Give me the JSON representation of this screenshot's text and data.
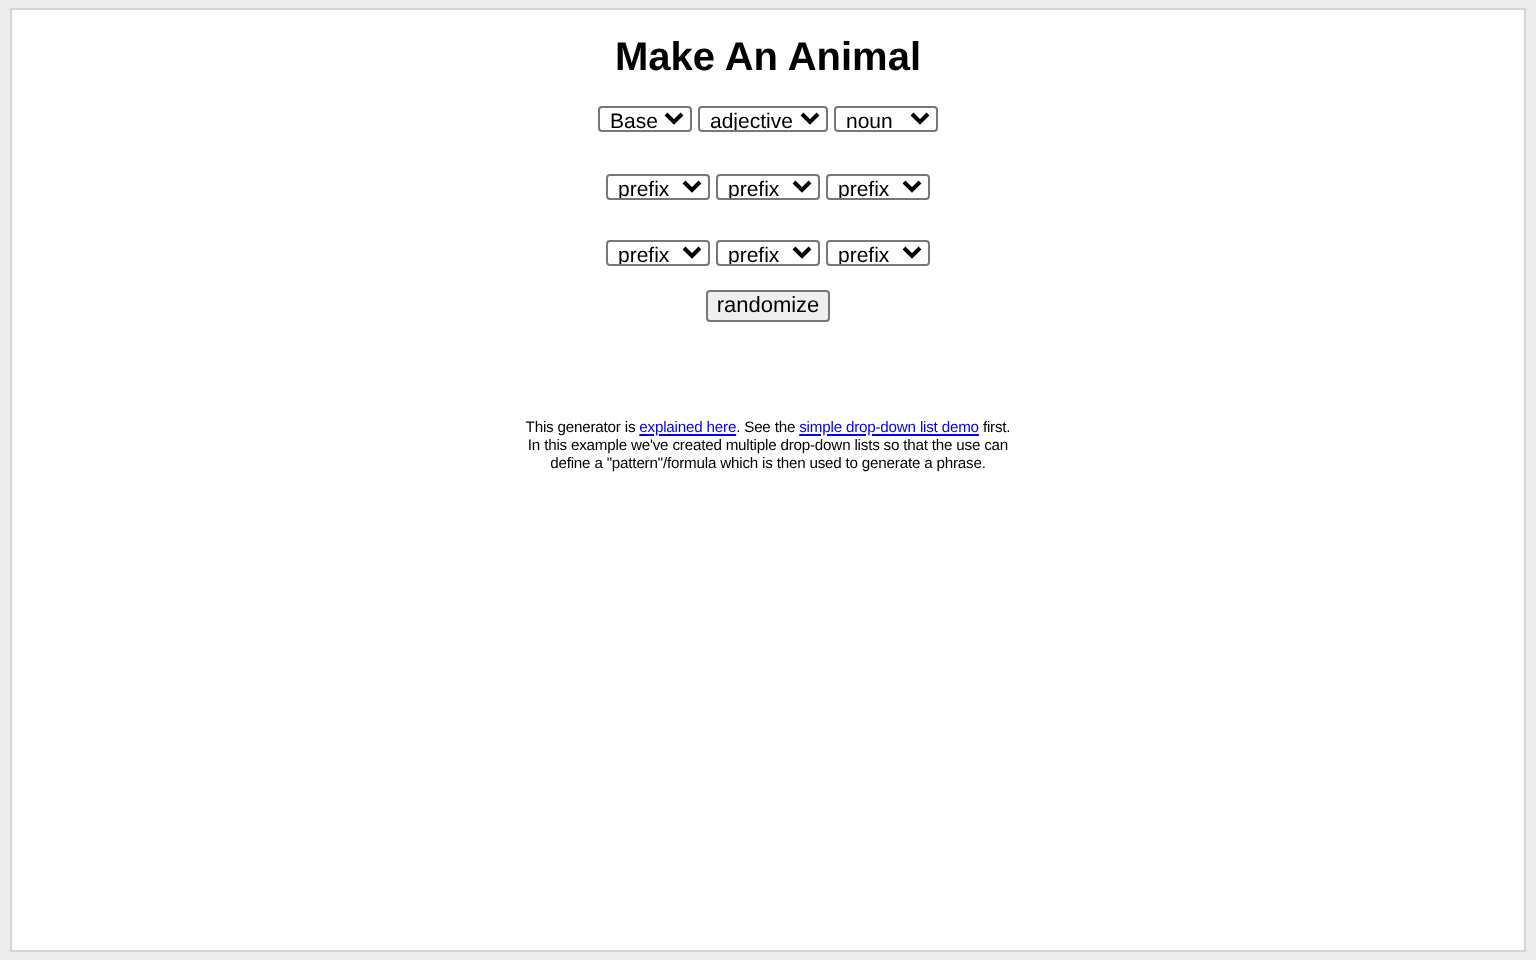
{
  "title": "Make An Animal",
  "rows": [
    {
      "selects": [
        "Base",
        "adjective",
        "noun"
      ]
    },
    {
      "selects": [
        "prefix",
        "prefix",
        "prefix"
      ]
    },
    {
      "selects": [
        "prefix",
        "prefix",
        "prefix"
      ]
    }
  ],
  "button": "randomize",
  "description": [
    {
      "kind": "text",
      "text": "This generator is "
    },
    {
      "kind": "link",
      "text": "explained here"
    },
    {
      "kind": "text",
      "text": ". See the "
    },
    {
      "kind": "link",
      "text": "simple drop-down list demo"
    },
    {
      "kind": "text",
      "text": " first. In this example we've created multiple drop-down lists so that the use can define a \"pattern\"/formula which is then used to generate a phrase."
    }
  ]
}
